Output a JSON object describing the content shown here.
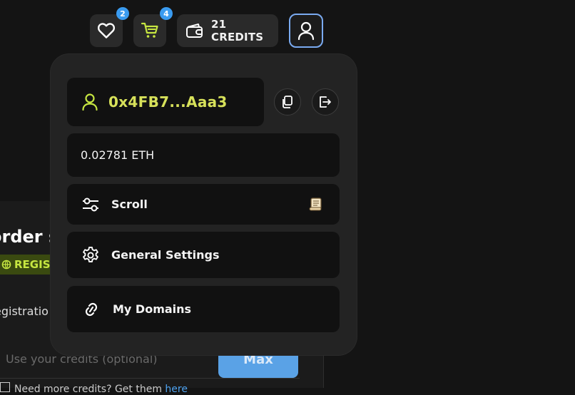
{
  "header": {
    "wishlist": {
      "icon": "heart-icon",
      "badge": "2"
    },
    "cart": {
      "icon": "cart-icon",
      "badge": "4",
      "icon_color": "#c6e641"
    },
    "credits": {
      "icon": "wallet-icon",
      "label": "21 CREDITS"
    },
    "profile": {
      "icon": "user-icon",
      "border_color": "#7aaaf0"
    }
  },
  "dropdown": {
    "address": {
      "icon": "user-icon",
      "text": "0x4FB7...Aaa3",
      "color": "#d7e15a"
    },
    "copy_button": {
      "icon": "copy-icon"
    },
    "logout_button": {
      "icon": "logout-icon"
    },
    "balance": "0.02781 ETH",
    "menu": [
      {
        "icon": "sliders-icon",
        "label": "Scroll",
        "trailing_icon": "scroll-emoji-icon"
      },
      {
        "icon": "gear-icon",
        "label": "General Settings"
      },
      {
        "icon": "link-icon",
        "label": "My Domains"
      }
    ]
  },
  "background_page": {
    "title": "order s",
    "pill": "REGISTR",
    "text": "egistratio",
    "input_placeholder": "Use your credits (optional)",
    "max_button": "Max",
    "note": "Need more credits? Get them",
    "note_link": "here"
  }
}
